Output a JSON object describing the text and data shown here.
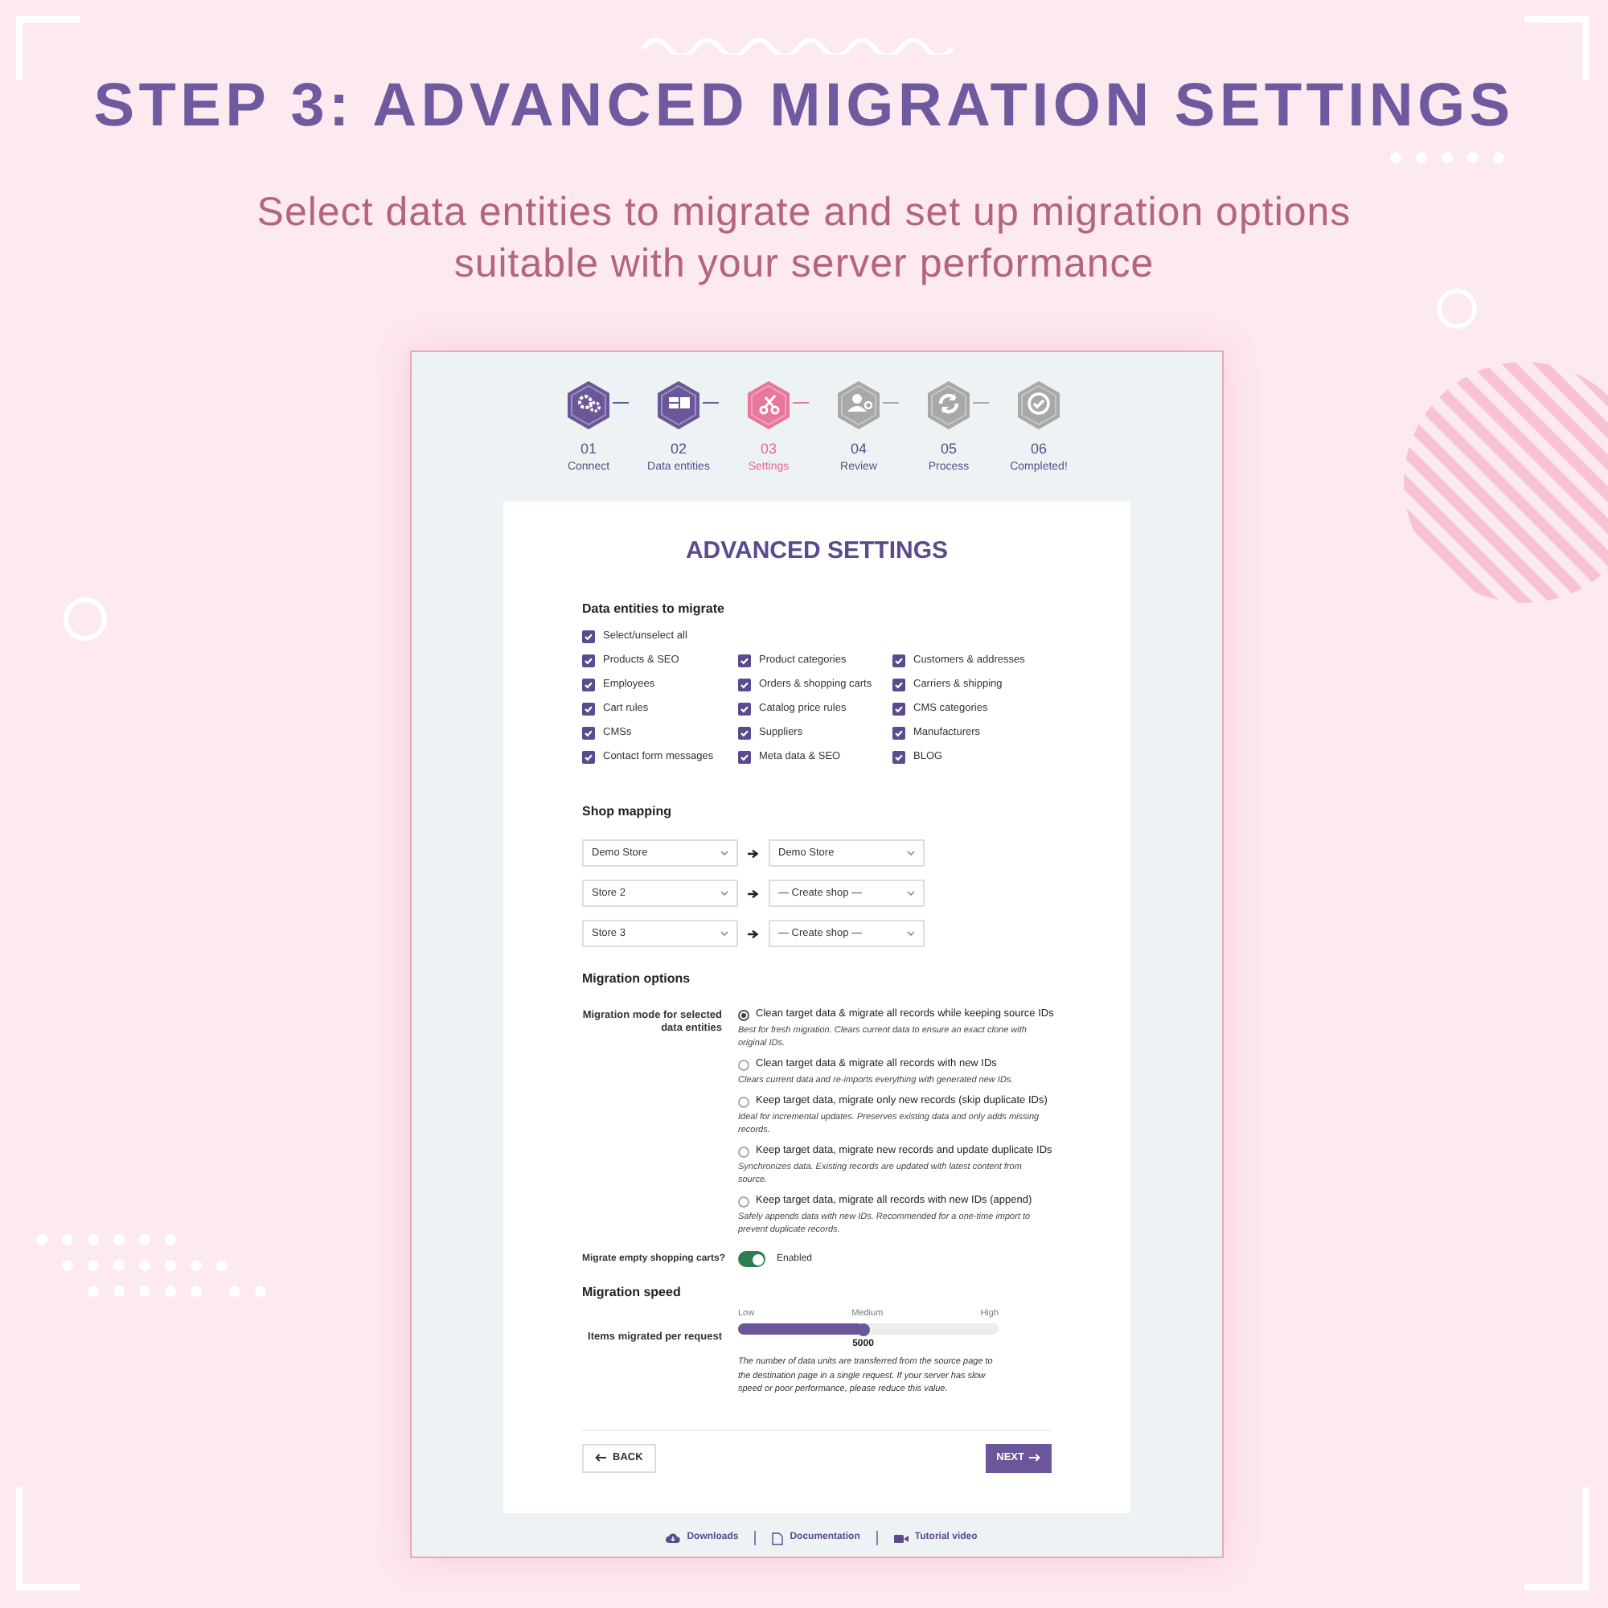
{
  "title": "STEP 3: ADVANCED MIGRATION SETTINGS",
  "subtitle": [
    "Select data entities to migrate and set up migration options",
    "suitable with your server performance"
  ],
  "steps": [
    {
      "number": "01",
      "label": "Connect",
      "completed": true,
      "selected": false,
      "kind": "gears"
    },
    {
      "number": "02",
      "label": "Data entities",
      "completed": true,
      "selected": false,
      "kind": "data"
    },
    {
      "number": "03",
      "label": "Settings",
      "completed": false,
      "selected": true,
      "kind": "tools"
    },
    {
      "number": "04",
      "label": "Review",
      "completed": false,
      "selected": false,
      "kind": "user"
    },
    {
      "number": "05",
      "label": "Process",
      "completed": false,
      "selected": false,
      "kind": "refresh"
    },
    {
      "number": "06",
      "label": "Completed!",
      "completed": false,
      "selected": false,
      "kind": "check"
    }
  ],
  "card": {
    "heading": "ADVANCED SETTINGS",
    "entities": {
      "heading": "Data entities to migrate",
      "select_all": {
        "label": "Select/unselect all",
        "checked": true
      },
      "items": [
        {
          "label": "Products & SEO",
          "checked": true
        },
        {
          "label": "Product categories",
          "checked": true
        },
        {
          "label": "Customers & addresses",
          "checked": true
        },
        {
          "label": "Employees",
          "checked": true
        },
        {
          "label": "Orders & shopping carts",
          "checked": true
        },
        {
          "label": "Carriers & shipping",
          "checked": true
        },
        {
          "label": "Cart rules",
          "checked": true
        },
        {
          "label": "Catalog price rules",
          "checked": true
        },
        {
          "label": "CMS categories",
          "checked": true
        },
        {
          "label": "CMSs",
          "checked": true
        },
        {
          "label": "Suppliers",
          "checked": true
        },
        {
          "label": "Manufacturers",
          "checked": true
        },
        {
          "label": "Contact form messages",
          "checked": true
        },
        {
          "label": "Meta data & SEO",
          "checked": true
        },
        {
          "label": "BLOG",
          "checked": true
        }
      ]
    },
    "shop_mapping": {
      "heading": "Shop mapping",
      "rows": [
        {
          "source": "Demo Store",
          "target": "Demo Store"
        },
        {
          "source": "Store 2",
          "target": "— Create shop —"
        },
        {
          "source": "Store 3",
          "target": "— Create shop —"
        }
      ]
    },
    "migration_options": {
      "heading": "Migration options",
      "mode_label": "Migration mode for selected data entities",
      "modes": [
        {
          "label": "Clean target data & migrate all records while keeping source IDs",
          "description": "Best for fresh migration. Clears current data to ensure an exact clone with original IDs.",
          "selected": true
        },
        {
          "label": "Clean target data & migrate all records with new IDs",
          "description": "Clears current data and re-imports everything with generated new IDs.",
          "selected": false
        },
        {
          "label": "Keep target data, migrate only new records (skip duplicate IDs)",
          "description": "Ideal for incremental updates. Preserves existing data and only adds missing records.",
          "selected": false
        },
        {
          "label": "Keep target data, migrate new records and update duplicate IDs",
          "description": "Synchronizes data. Existing records are updated with latest content from source.",
          "selected": false
        },
        {
          "label": "Keep target data, migrate all records with new IDs (append)",
          "description": "Safely appends data with new IDs. Recommended for a one-time import to prevent duplicate records.",
          "selected": false
        }
      ],
      "carts": {
        "label": "Migrate empty shopping carts?",
        "on": true,
        "state_text": "Enabled"
      }
    },
    "speed": {
      "heading": "Migration speed",
      "label": "Items migrated per request",
      "scale": [
        "Low",
        "Medium",
        "High"
      ],
      "level": 0.48,
      "value": "5000",
      "help": "The number of data units are transferred from the source page to the destination page in a single request. If your server has slow speed or poor performance, please reduce this value."
    },
    "back": "BACK",
    "next": "NEXT"
  },
  "footer_links": [
    {
      "label": "Downloads",
      "kind": "cloud"
    },
    {
      "label": "Documentation",
      "kind": "doc"
    },
    {
      "label": "Tutorial video",
      "kind": "video"
    }
  ]
}
